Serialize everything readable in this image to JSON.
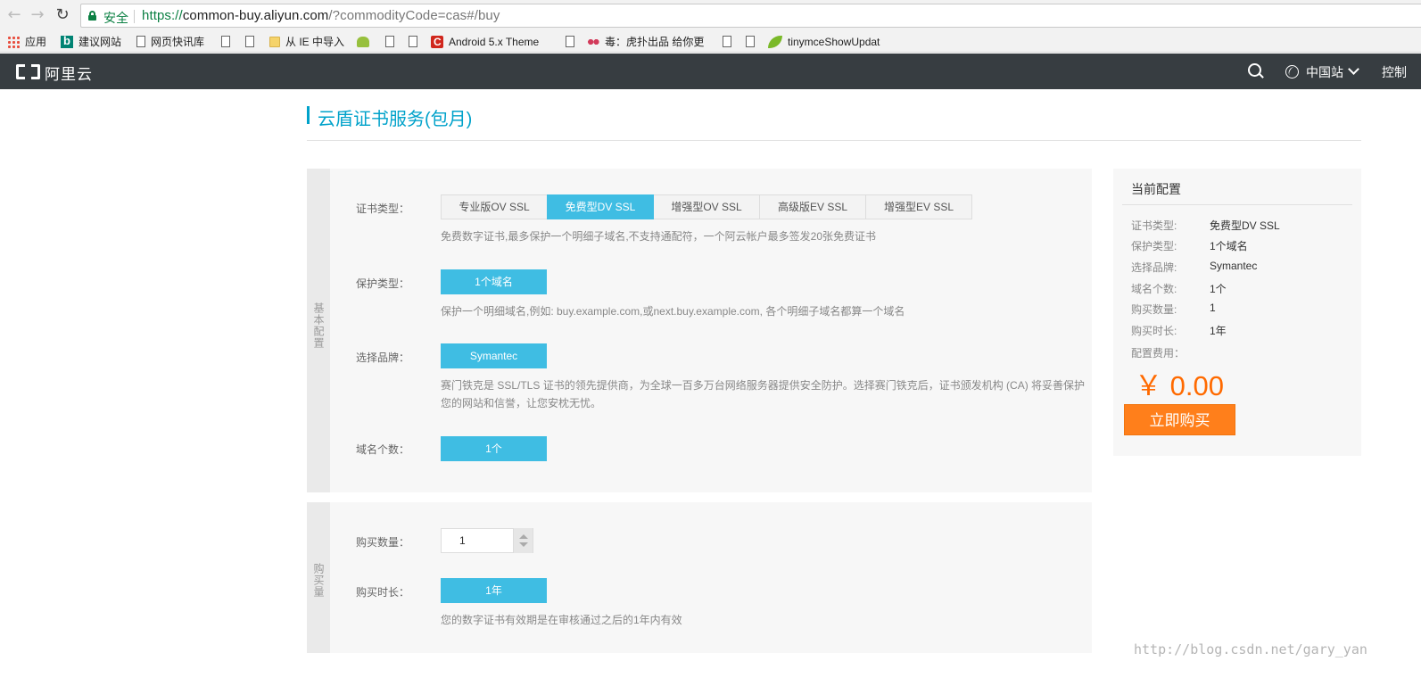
{
  "browser": {
    "secure_label": "安全",
    "url_scheme": "https://",
    "url_host": "common-buy.aliyun.com",
    "url_rest": "/?commodityCode=cas#/buy",
    "bookmarks": [
      {
        "label": "应用",
        "icon": "apps-icon"
      },
      {
        "label": "建议网站",
        "icon": "bing-icon"
      },
      {
        "label": "网页快讯库",
        "icon": "page-icon"
      },
      {
        "label": "",
        "icon": "page-icon"
      },
      {
        "label": "",
        "icon": "page-icon"
      },
      {
        "label": "从 IE 中导入",
        "icon": "folder-icon"
      },
      {
        "label": "",
        "icon": "android-icon"
      },
      {
        "label": "",
        "icon": "page-icon"
      },
      {
        "label": "",
        "icon": "page-icon"
      },
      {
        "label": "Android 5.x Theme",
        "icon": "c-icon"
      },
      {
        "label": "",
        "icon": "page-icon"
      },
      {
        "label": "毒：虎扑出品 给你更",
        "icon": "flower-icon"
      },
      {
        "label": "",
        "icon": "page-icon"
      },
      {
        "label": "",
        "icon": "page-icon"
      },
      {
        "label": "tinymceShowUpdat",
        "icon": "leaf-icon"
      }
    ]
  },
  "topbar": {
    "logo_text": "阿里云",
    "region": "中国站",
    "console": "控制"
  },
  "page": {
    "title": "云盾证书服务(包月)"
  },
  "basic": {
    "side_label": "基本配置",
    "cert_type_label": "证书类型：",
    "cert_types": [
      "专业版OV SSL",
      "免费型DV SSL",
      "增强型OV SSL",
      "高级版EV SSL",
      "增强型EV SSL"
    ],
    "selected_cert_type": 1,
    "cert_type_hint": "免费数字证书,最多保护一个明细子域名,不支持通配符，一个阿云帐户最多签发20张免费证书",
    "protect_label": "保护类型：",
    "protect_value": "1个域名",
    "protect_hint": "保护一个明细域名,例如: buy.example.com,或next.buy.example.com, 各个明细子域名都算一个域名",
    "brand_label": "选择品牌：",
    "brand_value": "Symantec",
    "brand_hint_line1": "赛门铁克是 SSL/TLS 证书的领先提供商，为全球一百多万台网络服务器提供安全防护。选择赛门铁克后，证书颁发机构 (CA) 将妥善保护",
    "brand_hint_line2": "您的网站和信誉，让您安枕无忧。",
    "domain_count_label": "域名个数：",
    "domain_count_value": "1个"
  },
  "purchase": {
    "side_label": "购买量",
    "quantity_label": "购买数量：",
    "quantity_value": "1",
    "duration_label": "购买时长：",
    "duration_value": "1年",
    "duration_hint": "您的数字证书有效期是在审核通过之后的1年内有效"
  },
  "summary": {
    "title": "当前配置",
    "rows": [
      {
        "label": "证书类型:",
        "value": "免费型DV SSL"
      },
      {
        "label": "保护类型:",
        "value": "1个域名"
      },
      {
        "label": "选择品牌:",
        "value": "Symantec"
      },
      {
        "label": "域名个数:",
        "value": "1个"
      },
      {
        "label": "购买数量:",
        "value": "1"
      },
      {
        "label": "购买时长:",
        "value": "1年"
      }
    ],
    "fee_label": "配置费用：",
    "price": "￥ 0.00",
    "buy_label": "立即购买"
  },
  "watermark": "http://blog.csdn.net/gary_yan",
  "colors": {
    "accent_blue": "#3fbde3",
    "title_blue": "#00a2ca",
    "price_orange": "#ff6a00",
    "buy_button": "#ff7f1b",
    "topbar": "#373d41"
  }
}
